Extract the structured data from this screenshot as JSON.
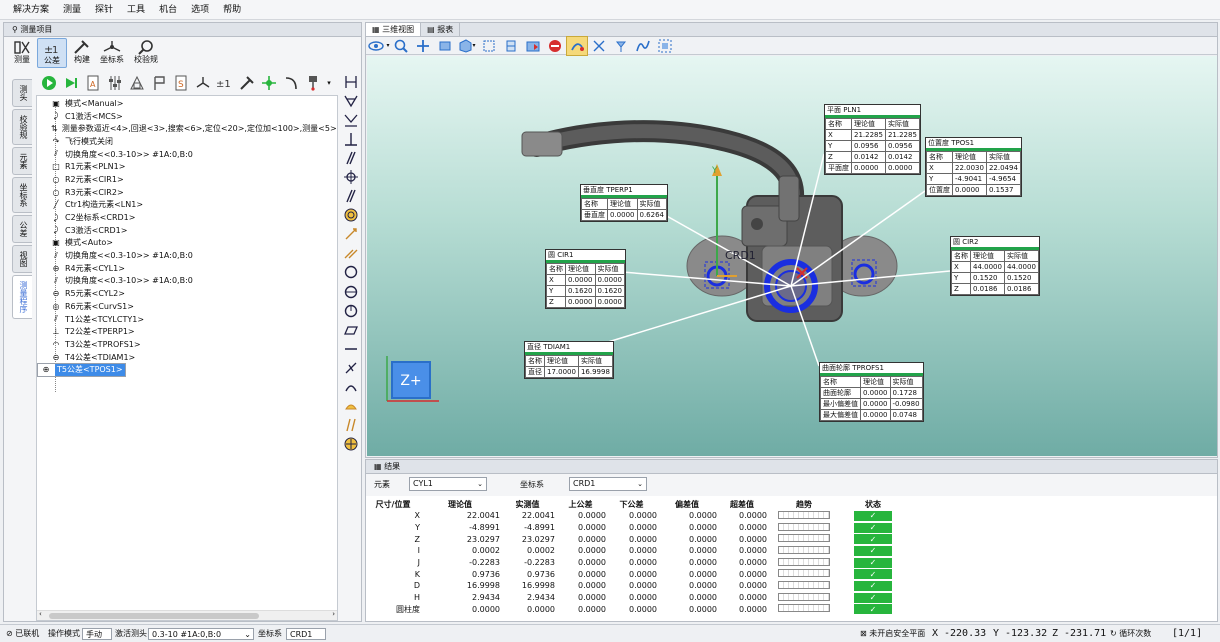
{
  "menu": [
    "解决方案",
    "测量",
    "探针",
    "工具",
    "机台",
    "选项",
    "帮助"
  ],
  "left_panel": {
    "title": "测量项目",
    "big_buttons": [
      {
        "label": "测量",
        "icon": "measure-icon"
      },
      {
        "label": "公差",
        "icon": "tolerance-icon"
      },
      {
        "label": "构建",
        "icon": "construct-icon"
      },
      {
        "label": "坐标系",
        "icon": "coordinate-icon"
      },
      {
        "label": "校验规",
        "icon": "gauge-icon"
      }
    ],
    "vertical_tabs": [
      "测头",
      "校验规",
      "元素",
      "坐标系",
      "公差",
      "视图",
      "测量程序"
    ],
    "tree": [
      {
        "icon": "mode-icon",
        "text": "模式<Manual>"
      },
      {
        "icon": "activate-icon",
        "text": "C1激活<MCS>"
      },
      {
        "icon": "params-icon",
        "text": "测量参数逼近<4>,回退<3>,搜索<6>,定位<20>,定位加<100>,测量<5>,测量加"
      },
      {
        "icon": "flight-icon",
        "text": "飞行模式关闭"
      },
      {
        "icon": "angle-icon",
        "text": "切换角度<<0.3-10>>  #1A:0,B:0"
      },
      {
        "icon": "plane-icon",
        "text": "R1元素<PLN1>"
      },
      {
        "icon": "circle-icon",
        "text": "R2元素<CIR1>"
      },
      {
        "icon": "circle-icon",
        "text": "R3元素<CIR2>"
      },
      {
        "icon": "line-icon",
        "text": "Ctr1构造元素<LN1>"
      },
      {
        "icon": "activate-icon",
        "text": "C2坐标系<CRD1>"
      },
      {
        "icon": "activate-icon",
        "text": "C3激活<CRD1>"
      },
      {
        "icon": "mode-icon",
        "text": "模式<Auto>"
      },
      {
        "icon": "angle-icon",
        "text": "切换角度<<0.3-10>>  #1A:0,B:0"
      },
      {
        "icon": "cylinder-icon",
        "text": "R4元素<CYL1>"
      },
      {
        "icon": "angle-icon",
        "text": "切换角度<<0.3-10>>  #1A:0,B:0"
      },
      {
        "icon": "cylinder-icon",
        "text": "R5元素<CYL2>"
      },
      {
        "icon": "curve-icon",
        "text": "R6元素<CurvS1>"
      },
      {
        "icon": "cylindricity-icon",
        "text": "T1公差<TCYLCTY1>"
      },
      {
        "icon": "perpendicularity-icon",
        "text": "T2公差<TPERP1>"
      },
      {
        "icon": "profile-icon",
        "text": "T3公差<TPROFS1>"
      },
      {
        "icon": "diameter-icon",
        "text": "T4公差<TDIAM1>"
      },
      {
        "icon": "position-icon",
        "text": "T5公差<TPOS1>",
        "selected": true
      }
    ]
  },
  "view_tabs": [
    "三维视图",
    "报表"
  ],
  "scene": {
    "axis_label": "Y",
    "part_label": "CRD1",
    "cube_label": "Z+",
    "callouts": [
      {
        "title": "平面 PLN1",
        "headers": [
          "名称",
          "理论值",
          "实际值"
        ],
        "rows": [
          [
            "X",
            "21.2285",
            "21.2285"
          ],
          [
            "Y",
            "0.0956",
            "0.0956"
          ],
          [
            "Z",
            "0.0142",
            "0.0142"
          ],
          [
            "平面度",
            "0.0000",
            "0.0000"
          ]
        ]
      },
      {
        "title": "位置度 TPOS1",
        "headers": [
          "名称",
          "理论值",
          "实际值"
        ],
        "rows": [
          [
            "X",
            "22.0030",
            "22.0494"
          ],
          [
            "Y",
            "-4.9041",
            "-4.9654"
          ],
          [
            "位置度",
            "0.0000",
            "0.1537"
          ]
        ]
      },
      {
        "title": "垂直度 TPERP1",
        "headers": [
          "名称",
          "理论值",
          "实际值"
        ],
        "rows": [
          [
            "垂直度",
            "0.0000",
            "0.6264"
          ]
        ]
      },
      {
        "title": "圆 CIR1",
        "headers": [
          "名称",
          "理论值",
          "实际值"
        ],
        "rows": [
          [
            "X",
            "0.0000",
            "0.0000"
          ],
          [
            "Y",
            "0.1620",
            "0.1620"
          ],
          [
            "Z",
            "0.0000",
            "0.0000"
          ]
        ]
      },
      {
        "title": "圆 CIR2",
        "headers": [
          "名称",
          "理论值",
          "实际值"
        ],
        "rows": [
          [
            "X",
            "44.0000",
            "44.0000"
          ],
          [
            "Y",
            "0.1520",
            "0.1520"
          ],
          [
            "Z",
            "0.0186",
            "0.0186"
          ]
        ]
      },
      {
        "title": "直径 TDIAM1",
        "headers": [
          "名称",
          "理论值",
          "实际值"
        ],
        "rows": [
          [
            "直径",
            "17.0000",
            "16.9998"
          ]
        ]
      },
      {
        "title": "曲面轮廓 TPROFS1",
        "headers": [
          "名称",
          "理论值",
          "实际值"
        ],
        "rows": [
          [
            "曲面轮廓",
            "0.0000",
            "0.1728"
          ],
          [
            "最小偏差值",
            "0.0000",
            "-0.0980"
          ],
          [
            "最大偏差值",
            "0.0000",
            "0.0748"
          ]
        ]
      }
    ]
  },
  "results": {
    "title": "结果",
    "element_label": "元素",
    "element_value": "CYL1",
    "coord_label": "坐标系",
    "coord_value": "CRD1",
    "headers": [
      "尺寸/位置",
      "理论值",
      "实测值",
      "上公差",
      "下公差",
      "偏差值",
      "超差值",
      "趋势",
      "状态"
    ],
    "rows": [
      [
        "X",
        "22.0041",
        "22.0041",
        "0.0000",
        "0.0000",
        "0.0000",
        "0.0000"
      ],
      [
        "Y",
        "-4.8991",
        "-4.8991",
        "0.0000",
        "0.0000",
        "0.0000",
        "0.0000"
      ],
      [
        "Z",
        "23.0297",
        "23.0297",
        "0.0000",
        "0.0000",
        "0.0000",
        "0.0000"
      ],
      [
        "I",
        "0.0002",
        "0.0002",
        "0.0000",
        "0.0000",
        "0.0000",
        "0.0000"
      ],
      [
        "J",
        "-0.2283",
        "-0.2283",
        "0.0000",
        "0.0000",
        "0.0000",
        "0.0000"
      ],
      [
        "K",
        "0.9736",
        "0.9736",
        "0.0000",
        "0.0000",
        "0.0000",
        "0.0000"
      ],
      [
        "D",
        "16.9998",
        "16.9998",
        "0.0000",
        "0.0000",
        "0.0000",
        "0.0000"
      ],
      [
        "H",
        "2.9434",
        "2.9434",
        "0.0000",
        "0.0000",
        "0.0000",
        "0.0000"
      ],
      [
        "圆柱度",
        "0.0000",
        "0.0000",
        "0.0000",
        "0.0000",
        "0.0000",
        "0.0000"
      ]
    ],
    "status_mark": "✓"
  },
  "status": {
    "connection": "已联机",
    "op_mode_label": "操作模式",
    "op_mode_value": "手动",
    "probe_label": "激活测头",
    "probe_value": "0.3-10 #1A:0,B:0",
    "coord_label": "坐标系",
    "coord_value": "CRD1",
    "safety": "未开启安全平面",
    "x_label": "X",
    "x_value": "-220.33",
    "y_label": "Y",
    "y_value": "-123.32",
    "z_label": "Z",
    "z_value": "-231.71",
    "loop_label": "循环次数",
    "loop_value": "[1/1]"
  },
  "colors": {
    "accent": "#3d8be8",
    "ok": "#27b53d",
    "stop": "#d62d2d",
    "header_bar": "#22a34a"
  }
}
